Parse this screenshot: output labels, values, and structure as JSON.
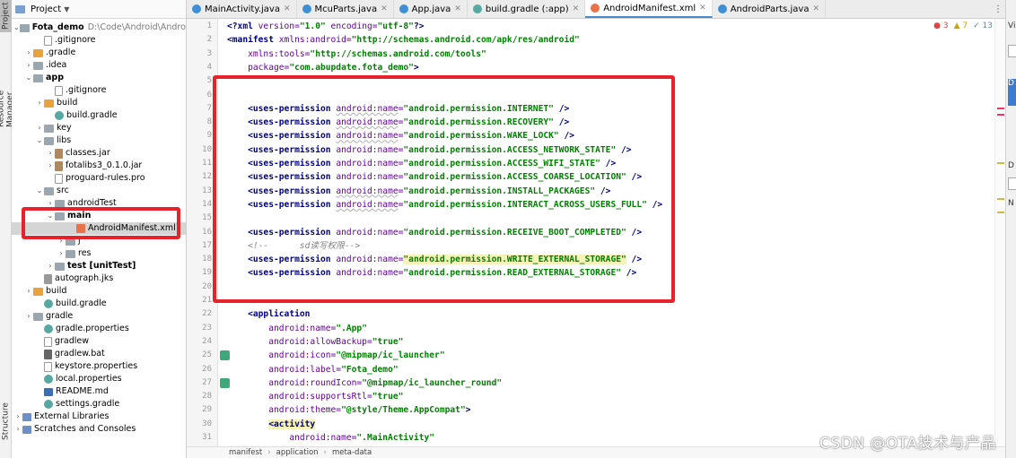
{
  "tool_strip": {
    "project_tab": "Project",
    "resource_manager_tab": "Resource Manager",
    "structure_tab": "Structure"
  },
  "project_panel": {
    "header_label": "Project",
    "tree": [
      {
        "label": "Fota_demo",
        "path": "D:\\Code\\Android\\AndroidSt",
        "icon": "folder-icon",
        "indent": 0,
        "expanded": true,
        "bold": true
      },
      {
        "label": ".gitignore",
        "icon": "file-icon",
        "indent": 2
      },
      {
        "label": ".gradle",
        "icon": "folder-orange-icon",
        "indent": 1,
        "collapsed": true
      },
      {
        "label": ".idea",
        "icon": "folder-icon",
        "indent": 1,
        "collapsed": true
      },
      {
        "label": "app",
        "icon": "folder-icon",
        "indent": 1,
        "expanded": true,
        "bold": true
      },
      {
        "label": ".gitignore",
        "icon": "file-icon",
        "indent": 3
      },
      {
        "label": "build",
        "icon": "folder-orange-icon",
        "indent": 2,
        "collapsed": true
      },
      {
        "label": "build.gradle",
        "icon": "gradle-icon",
        "indent": 3
      },
      {
        "label": "key",
        "icon": "folder-icon",
        "indent": 2,
        "collapsed": true
      },
      {
        "label": "libs",
        "icon": "folder-icon",
        "indent": 2,
        "expanded": true
      },
      {
        "label": "classes.jar",
        "icon": "jar-icon",
        "indent": 3,
        "collapsed": true
      },
      {
        "label": "fotalibs3_0.1.0.jar",
        "icon": "jar-icon",
        "indent": 3,
        "collapsed": true
      },
      {
        "label": "proguard-rules.pro",
        "icon": "file-icon",
        "indent": 3
      },
      {
        "label": "src",
        "icon": "folder-icon",
        "indent": 2,
        "expanded": true
      },
      {
        "label": "androidTest",
        "icon": "folder-icon",
        "indent": 3,
        "collapsed": true
      },
      {
        "label": "main",
        "icon": "folder-icon",
        "indent": 3,
        "expanded": true,
        "bold": true
      },
      {
        "label": "AndroidManifest.xml",
        "icon": "xml-icon",
        "indent": 5,
        "selected": true
      },
      {
        "label": "j",
        "icon": "folder-icon",
        "indent": 4,
        "collapsed": true
      },
      {
        "label": "res",
        "icon": "folder-icon",
        "indent": 4,
        "collapsed": true
      },
      {
        "label": "test [unitTest]",
        "icon": "folder-icon",
        "indent": 3,
        "collapsed": true,
        "bold": true
      },
      {
        "label": "autograph.jks",
        "icon": "key-icon",
        "indent": 2
      },
      {
        "label": "build",
        "icon": "folder-orange-icon",
        "indent": 1,
        "collapsed": true
      },
      {
        "label": "build.gradle",
        "icon": "gradle-icon",
        "indent": 2
      },
      {
        "label": "gradle",
        "icon": "folder-icon",
        "indent": 1,
        "collapsed": true
      },
      {
        "label": "gradle.properties",
        "icon": "gradle-icon",
        "indent": 2
      },
      {
        "label": "gradlew",
        "icon": "file-icon",
        "indent": 2
      },
      {
        "label": "gradlew.bat",
        "icon": "bat-icon",
        "indent": 2
      },
      {
        "label": "keystore.properties",
        "icon": "file-icon",
        "indent": 2
      },
      {
        "label": "local.properties",
        "icon": "gradle-icon",
        "indent": 2
      },
      {
        "label": "README.md",
        "icon": "md-icon",
        "indent": 2
      },
      {
        "label": "settings.gradle",
        "icon": "gradle-icon",
        "indent": 2
      },
      {
        "label": "External Libraries",
        "icon": "lib-icon",
        "indent": 0,
        "collapsed": true
      },
      {
        "label": "Scratches and Consoles",
        "icon": "lib-icon",
        "indent": 0,
        "collapsed": true
      }
    ]
  },
  "tabs": [
    {
      "label": "MainActivity.java",
      "color": "#3f8fd6"
    },
    {
      "label": "McuParts.java",
      "color": "#3f8fd6"
    },
    {
      "label": "App.java",
      "color": "#3f8fd6"
    },
    {
      "label": "build.gradle (:app)",
      "color": "#56a8a0"
    },
    {
      "label": "AndroidManifest.xml",
      "color": "#e8734a",
      "active": true
    },
    {
      "label": "AndroidParts.java",
      "color": "#3f8fd6"
    }
  ],
  "inspection": {
    "errors": "3",
    "warnings": "7",
    "weak": "13"
  },
  "editor": {
    "line_numbers": [
      "1",
      "2",
      "3",
      "4",
      "5",
      "6",
      "7",
      "8",
      "9",
      "10",
      "11",
      "12",
      "13",
      "14",
      "15",
      "16",
      "17",
      "18",
      "19",
      "20",
      "21",
      "22",
      "23",
      "24",
      "25",
      "26",
      "27",
      "28",
      "29",
      "30",
      "31"
    ],
    "lines": [
      [
        [
          "t-tag",
          "<?xml "
        ],
        [
          "t-attr",
          "version="
        ],
        [
          "t-val",
          "\"1.0\""
        ],
        [
          "t-attr",
          " encoding="
        ],
        [
          "t-val",
          "\"utf-8\""
        ],
        [
          "t-tag",
          "?>"
        ]
      ],
      [
        [
          "t-tag",
          "<manifest "
        ],
        [
          "t-attr",
          "xmlns:android="
        ],
        [
          "t-val",
          "\"http://schemas.android.com/apk/res/android\""
        ]
      ],
      [
        [
          "t-pl",
          "    "
        ],
        [
          "t-attr",
          "xmlns:tools="
        ],
        [
          "t-val",
          "\"http://schemas.android.com/tools\""
        ]
      ],
      [
        [
          "t-pl",
          "    "
        ],
        [
          "t-attr",
          "package="
        ],
        [
          "t-val",
          "\"com.abupdate.fota_demo\""
        ],
        [
          "t-tag",
          ">"
        ]
      ],
      [],
      [],
      [
        [
          "t-pl",
          "    "
        ],
        [
          "t-tag",
          "<uses-permission "
        ],
        [
          "t-attrns",
          "android:name"
        ],
        [
          "t-attr",
          "="
        ],
        [
          "t-val",
          "\"android.permission.INTERNET\""
        ],
        [
          "t-tag",
          " />"
        ]
      ],
      [
        [
          "t-pl",
          "    "
        ],
        [
          "t-tag",
          "<uses-permission "
        ],
        [
          "t-attrns",
          "android:name"
        ],
        [
          "t-attr",
          "="
        ],
        [
          "t-val",
          "\"android.permission.RECOVERY\""
        ],
        [
          "t-tag",
          " />"
        ]
      ],
      [
        [
          "t-pl",
          "    "
        ],
        [
          "t-tag",
          "<uses-permission "
        ],
        [
          "t-attrns",
          "android:name"
        ],
        [
          "t-attr",
          "="
        ],
        [
          "t-val",
          "\"android.permission.WAKE_LOCK\""
        ],
        [
          "t-tag",
          " />"
        ]
      ],
      [
        [
          "t-pl",
          "    "
        ],
        [
          "t-tag",
          "<uses-permission "
        ],
        [
          "t-attr",
          "android:name="
        ],
        [
          "t-val",
          "\"android.permission.ACCESS_NETWORK_STATE\""
        ],
        [
          "t-tag",
          " />"
        ]
      ],
      [
        [
          "t-pl",
          "    "
        ],
        [
          "t-tag",
          "<uses-permission "
        ],
        [
          "t-attr",
          "android:name="
        ],
        [
          "t-val",
          "\"android.permission.ACCESS_WIFI_STATE\""
        ],
        [
          "t-tag",
          " />"
        ]
      ],
      [
        [
          "t-pl",
          "    "
        ],
        [
          "t-tag",
          "<uses-permission "
        ],
        [
          "t-attr",
          "android:name="
        ],
        [
          "t-val",
          "\"android.permission.ACCESS_COARSE_LOCATION\""
        ],
        [
          "t-tag",
          " />"
        ]
      ],
      [
        [
          "t-pl",
          "    "
        ],
        [
          "t-tag",
          "<uses-permission "
        ],
        [
          "t-attrns",
          "android:name"
        ],
        [
          "t-attr",
          "="
        ],
        [
          "t-val",
          "\"android.permission.INSTALL_PACKAGES\""
        ],
        [
          "t-tag",
          " />"
        ]
      ],
      [
        [
          "t-pl",
          "    "
        ],
        [
          "t-tag",
          "<uses-permission "
        ],
        [
          "t-attrns",
          "android:name"
        ],
        [
          "t-attr",
          "="
        ],
        [
          "t-val",
          "\"android.permission.INTERACT_ACROSS_USERS_FULL\""
        ],
        [
          "t-tag",
          " />"
        ]
      ],
      [],
      [
        [
          "t-pl",
          "    "
        ],
        [
          "t-tag",
          "<uses-permission "
        ],
        [
          "t-attr",
          "android:name="
        ],
        [
          "t-val",
          "\"android.permission.RECEIVE_BOOT_COMPLETED\""
        ],
        [
          "t-tag",
          " />"
        ]
      ],
      [
        [
          "t-cm",
          "    <!--      sd读写权限-->"
        ]
      ],
      [
        [
          "t-pl",
          "    "
        ],
        [
          "t-tag",
          "<uses-permission "
        ],
        [
          "t-attr",
          "android:name="
        ],
        [
          "t-val t-hl",
          "\"android.permission.WRITE_EXTERNAL_STORAGE\""
        ],
        [
          "t-tag",
          " />"
        ]
      ],
      [
        [
          "t-pl",
          "    "
        ],
        [
          "t-tag",
          "<uses-permission "
        ],
        [
          "t-attr",
          "android:name="
        ],
        [
          "t-val",
          "\"android.permission.READ_EXTERNAL_STORAGE\""
        ],
        [
          "t-tag",
          " />"
        ]
      ],
      [],
      [],
      [
        [
          "t-pl",
          "    "
        ],
        [
          "t-tag",
          "<application"
        ]
      ],
      [
        [
          "t-pl",
          "        "
        ],
        [
          "t-attr",
          "android:name="
        ],
        [
          "t-val",
          "\".App\""
        ]
      ],
      [
        [
          "t-pl",
          "        "
        ],
        [
          "t-attr",
          "android:allowBackup="
        ],
        [
          "t-val",
          "\"true\""
        ]
      ],
      [
        [
          "t-pl",
          "        "
        ],
        [
          "t-attr",
          "android:icon="
        ],
        [
          "t-val",
          "\"@mipmap/ic_launcher\""
        ]
      ],
      [
        [
          "t-pl",
          "        "
        ],
        [
          "t-attr",
          "android:label="
        ],
        [
          "t-val",
          "\"Fota_demo\""
        ]
      ],
      [
        [
          "t-pl",
          "        "
        ],
        [
          "t-attr",
          "android:roundIcon="
        ],
        [
          "t-val",
          "\"@mipmap/ic_launcher_round\""
        ]
      ],
      [
        [
          "t-pl",
          "        "
        ],
        [
          "t-attr",
          "android:supportsRtl="
        ],
        [
          "t-val",
          "\"true\""
        ]
      ],
      [
        [
          "t-pl",
          "        "
        ],
        [
          "t-attr",
          "android:theme="
        ],
        [
          "t-val",
          "\"@style/Theme.AppCompat\""
        ],
        [
          "t-tag",
          ">"
        ]
      ],
      [
        [
          "t-pl",
          "        "
        ],
        [
          "t-tag t-hl",
          "<activity"
        ]
      ],
      [
        [
          "t-pl",
          "            "
        ],
        [
          "t-attr",
          "android:name="
        ],
        [
          "t-val",
          "\".MainActivity\""
        ]
      ]
    ]
  },
  "breadcrumb": [
    "manifest",
    "application",
    "meta-data"
  ],
  "right_panel": {
    "labels": [
      "Vi",
      "D",
      "D",
      "N"
    ]
  },
  "watermark": "CSDN @OTA技术与产品",
  "colors": {
    "highlight_border": "#e8222a",
    "accent": "#4a88c7"
  }
}
